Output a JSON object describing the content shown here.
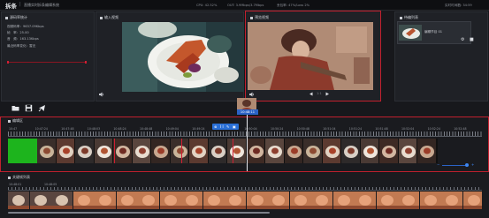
{
  "app": {
    "title": "拆条",
    "separator": "|",
    "subtitle": "直播实时拆条编辑系统"
  },
  "status": {
    "cpu": "CPU: 42.52%",
    "out": "OUT: 3.9Mbps/3.7Mbps",
    "loss": "丢包率: 47%/Loss 2%",
    "time": "实时时间戳: 34:59"
  },
  "stats_panel": {
    "title": "源码率统计",
    "lines": [
      "视频码率：9637.09Kbps",
      "帧　率：25.00",
      "音　频：163.13Kbps",
      "最近码率变化：暂无"
    ]
  },
  "input_panel": {
    "title": "输入视频"
  },
  "preview_panel": {
    "title": "预览视频",
    "play": "1:1"
  },
  "publish_panel": {
    "title": "待编列表",
    "item_name": "编辑节目 01"
  },
  "marker": {
    "time": "10:48:11"
  },
  "clip_controls": [
    "⊗",
    "I I",
    "✎",
    "▣"
  ],
  "edit_track": {
    "title": "编辑区",
    "ticks": [
      "10:47",
      "10:47:24",
      "10:47:48",
      "10:48:03",
      "10:48:24",
      "10:48:48",
      "10:49:04",
      "10:49:24",
      "10:49:48",
      "10:50:04",
      "10:50:24",
      "10:50:48",
      "10:51:04",
      "10:51:24",
      "10:51:48",
      "10:52:04",
      "10:52:24",
      "10:52:48"
    ]
  },
  "keyframes": {
    "title": "关键帧列表",
    "ticks": [
      "10:48:01",
      "10:48:05"
    ]
  },
  "colors": {
    "accent_red": "#c2202e",
    "accent_blue": "#2b63c6",
    "green_clip": "#1db41d"
  }
}
